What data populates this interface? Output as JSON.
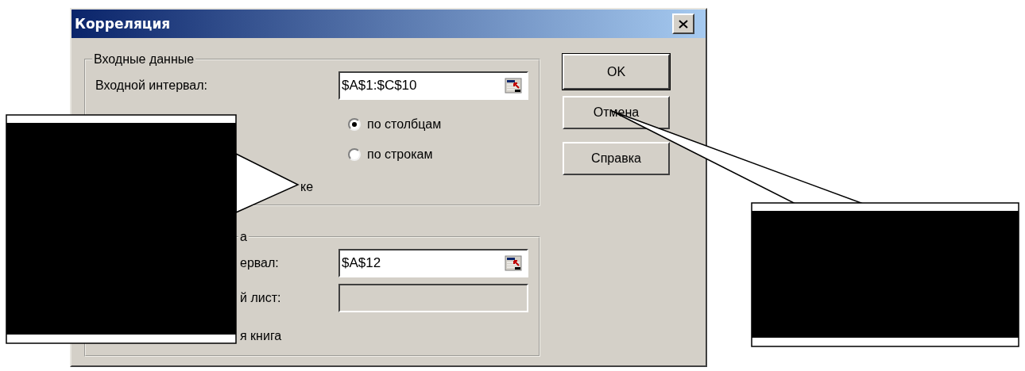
{
  "window": {
    "title": "Корреляция"
  },
  "groups": [
    {
      "title": "Входные данные",
      "rows": [
        {
          "kind": "field",
          "label": "Входной интервал:",
          "value": "$A$1:$C$10",
          "disabled": false
        },
        {
          "kind": "radio",
          "label": "по столбцам",
          "selected": true
        },
        {
          "kind": "radio",
          "label": "по строкам",
          "selected": false
        },
        {
          "kind": "text",
          "label": "ке"
        }
      ]
    },
    {
      "title": "а",
      "rows": [
        {
          "kind": "field",
          "label": "ервал:",
          "value": "$A$12",
          "disabled": false
        },
        {
          "kind": "field",
          "label": "й лист:",
          "disabled": true
        },
        {
          "kind": "text",
          "label": "я книга"
        }
      ]
    }
  ],
  "buttons": [
    {
      "label": "OK",
      "default": true
    },
    {
      "label": "Отмена",
      "default": false
    },
    {
      "label": "Справка",
      "default": false
    }
  ],
  "callouts": [
    {
      "kind": "callout"
    },
    {
      "kind": "callout"
    }
  ]
}
